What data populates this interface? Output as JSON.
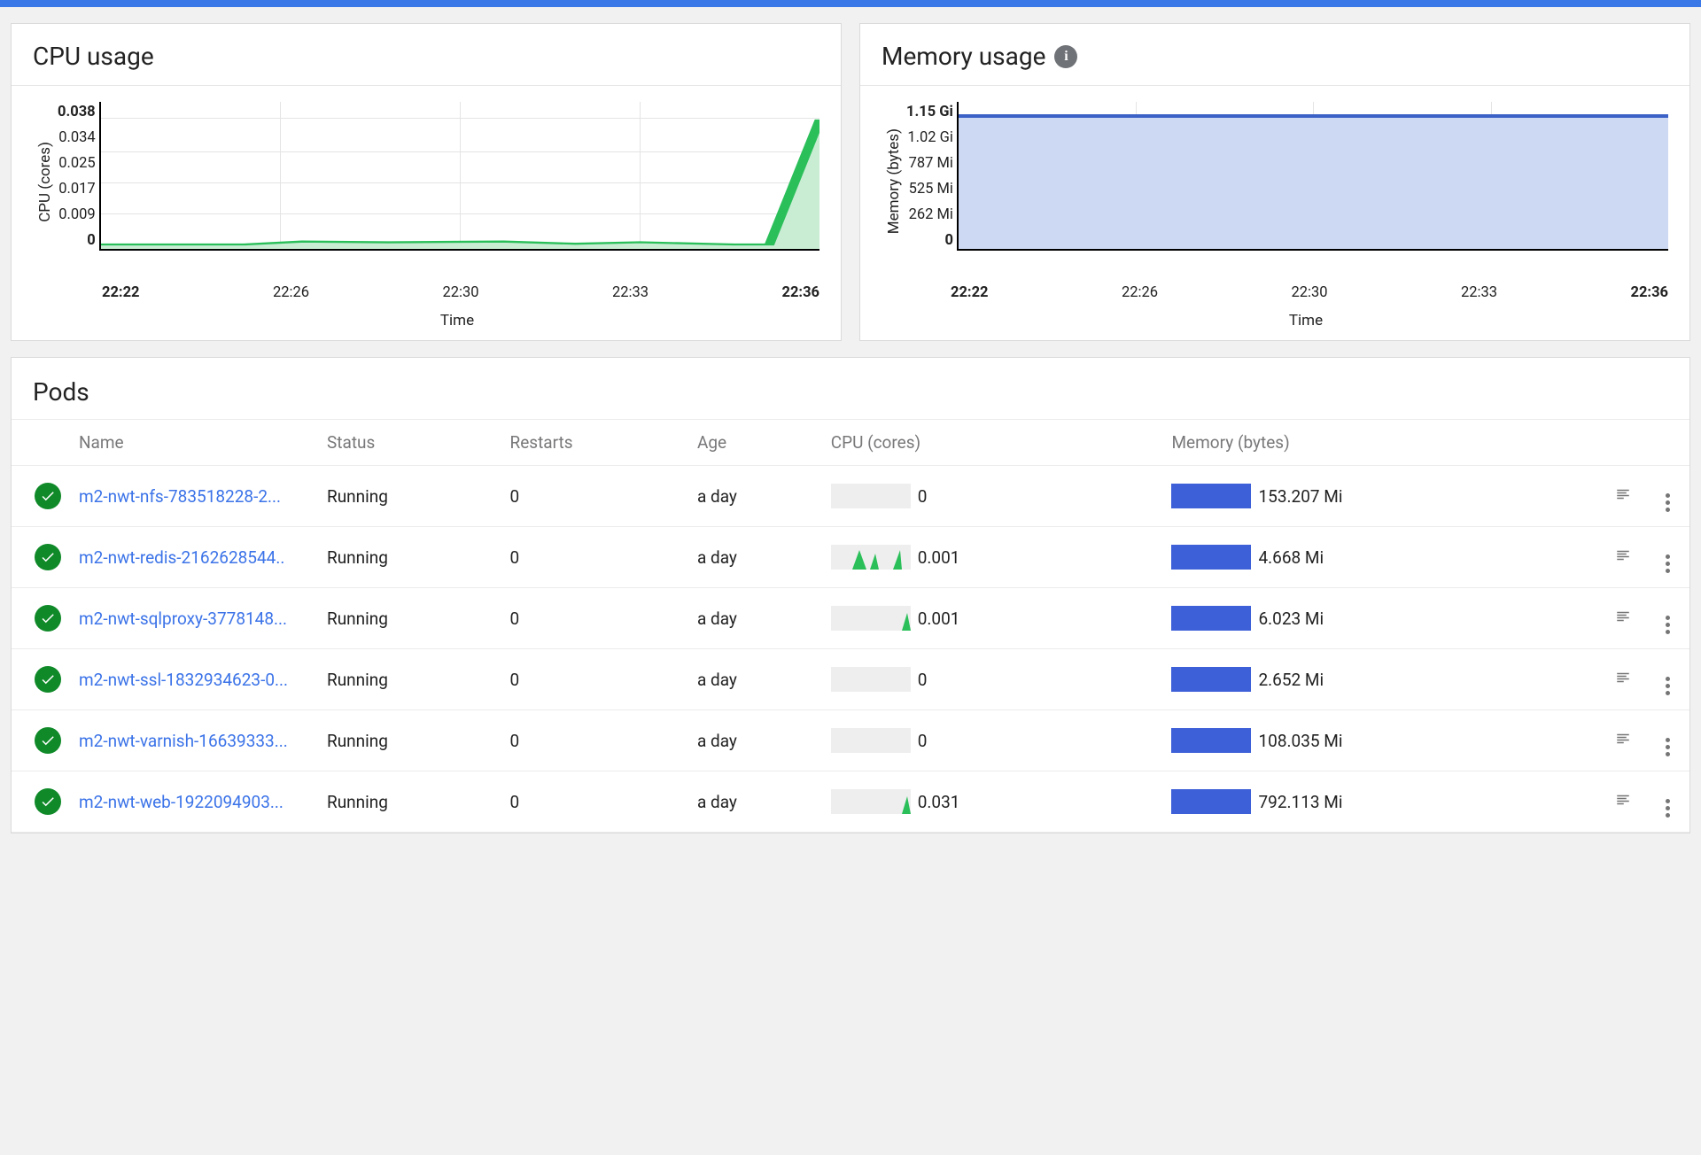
{
  "cpu_chart": {
    "title": "CPU usage",
    "ylabel": "CPU (cores)",
    "xlabel": "Time",
    "yticks": [
      "0.038",
      "0.034",
      "0.025",
      "0.017",
      "0.009",
      "0"
    ],
    "xticks": [
      "22:22",
      "22:26",
      "22:30",
      "22:33",
      "22:36"
    ]
  },
  "mem_chart": {
    "title": "Memory usage",
    "ylabel": "Memory (bytes)",
    "xlabel": "Time",
    "yticks": [
      "1.15 Gi",
      "1.02 Gi",
      "787 Mi",
      "525 Mi",
      "262 Mi",
      "0"
    ],
    "xticks": [
      "22:22",
      "22:26",
      "22:30",
      "22:33",
      "22:36"
    ]
  },
  "pods": {
    "title": "Pods",
    "columns": {
      "name": "Name",
      "status": "Status",
      "restarts": "Restarts",
      "age": "Age",
      "cpu": "CPU (cores)",
      "memory": "Memory (bytes)"
    },
    "rows": [
      {
        "name": "m2-nwt-nfs-783518228-2...",
        "status": "Running",
        "restarts": "0",
        "age": "a day",
        "cpu": "0",
        "memory": "153.207 Mi",
        "spark": "flat"
      },
      {
        "name": "m2-nwt-redis-2162628544..",
        "status": "Running",
        "restarts": "0",
        "age": "a day",
        "cpu": "0.001",
        "memory": "4.668 Mi",
        "spark": "spikes"
      },
      {
        "name": "m2-nwt-sqlproxy-3778148...",
        "status": "Running",
        "restarts": "0",
        "age": "a day",
        "cpu": "0.001",
        "memory": "6.023 Mi",
        "spark": "small"
      },
      {
        "name": "m2-nwt-ssl-1832934623-0...",
        "status": "Running",
        "restarts": "0",
        "age": "a day",
        "cpu": "0",
        "memory": "2.652 Mi",
        "spark": "flat"
      },
      {
        "name": "m2-nwt-varnish-16639333...",
        "status": "Running",
        "restarts": "0",
        "age": "a day",
        "cpu": "0",
        "memory": "108.035 Mi",
        "spark": "flat"
      },
      {
        "name": "m2-nwt-web-1922094903...",
        "status": "Running",
        "restarts": "0",
        "age": "a day",
        "cpu": "0.031",
        "memory": "792.113 Mi",
        "spark": "small"
      }
    ]
  },
  "chart_data": [
    {
      "type": "line",
      "title": "CPU usage",
      "xlabel": "Time",
      "ylabel": "CPU (cores)",
      "x": [
        "22:22",
        "22:23",
        "22:24",
        "22:25",
        "22:26",
        "22:27",
        "22:28",
        "22:29",
        "22:30",
        "22:31",
        "22:32",
        "22:33",
        "22:34",
        "22:35",
        "22:36"
      ],
      "values": [
        0.001,
        0.001,
        0.001,
        0.001,
        0.002,
        0.002,
        0.002,
        0.002,
        0.001,
        0.002,
        0.002,
        0.001,
        0.001,
        0.001,
        0.034
      ],
      "ylim": [
        0,
        0.038
      ]
    },
    {
      "type": "area",
      "title": "Memory usage",
      "xlabel": "Time",
      "ylabel": "Memory (bytes)",
      "x": [
        "22:22",
        "22:26",
        "22:30",
        "22:33",
        "22:36"
      ],
      "values": [
        1.02,
        1.02,
        1.02,
        1.02,
        1.02
      ],
      "unit": "Gi",
      "ylim": [
        0,
        1.15
      ]
    }
  ]
}
